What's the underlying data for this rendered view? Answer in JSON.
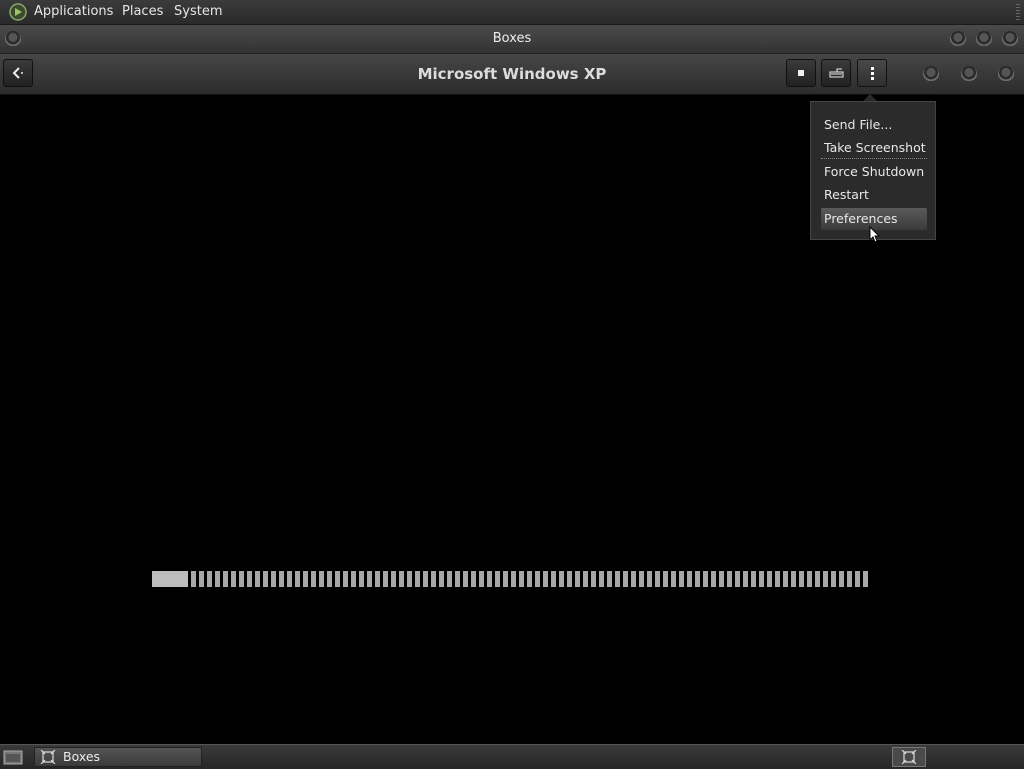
{
  "top_panel": {
    "menu": [
      "Applications",
      "Places",
      "System"
    ]
  },
  "window": {
    "title": "Boxes"
  },
  "header": {
    "title": "Microsoft Windows XP",
    "buttons": [
      "back-icon",
      "stop-icon",
      "keyboard-icon",
      "menu-icon"
    ]
  },
  "popup_menu": {
    "items": [
      "Send File...",
      "Take Screenshot",
      "Force Shutdown",
      "Restart",
      "Preferences"
    ],
    "highlighted": "Preferences"
  },
  "taskbar": {
    "window_label": "Boxes"
  },
  "loading": {
    "progress": 0.05
  }
}
